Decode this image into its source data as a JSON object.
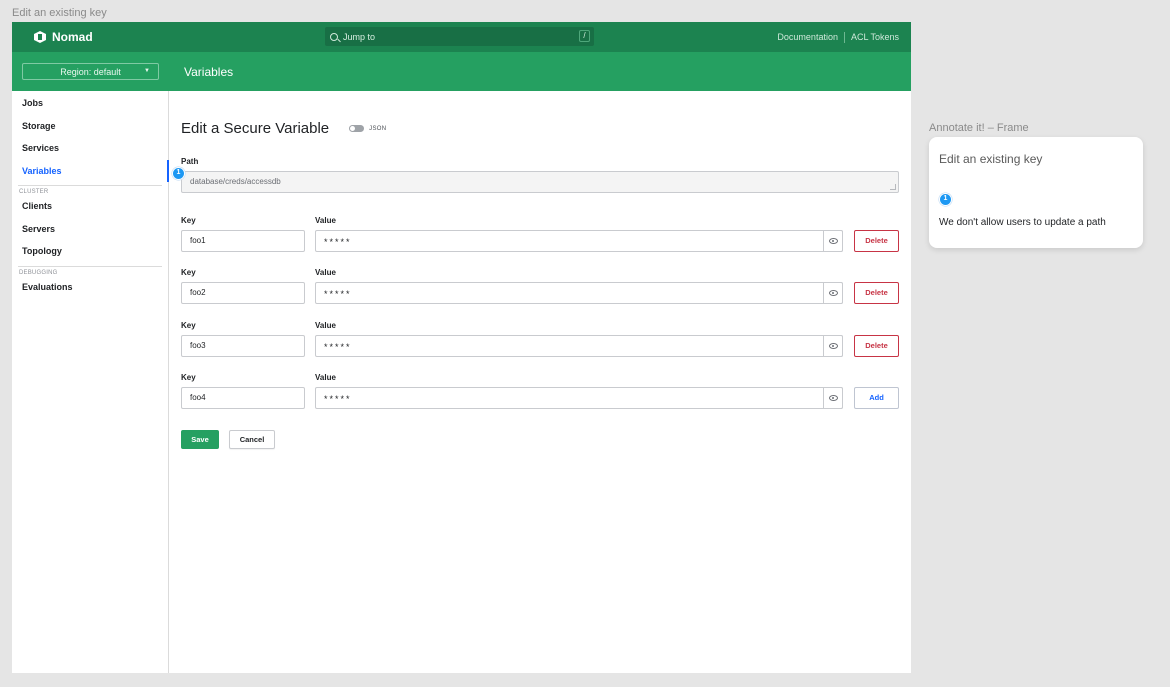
{
  "canvas": {
    "frame_label": "Edit an existing key"
  },
  "header": {
    "brand": "Nomad",
    "search_placeholder": "Jump to",
    "search_shortcut": "/",
    "links": [
      "Documentation",
      "ACL Tokens"
    ]
  },
  "subheader": {
    "region": "Region: default",
    "page_title": "Variables"
  },
  "sidebar": {
    "items_top": [
      {
        "label": "Jobs",
        "active": false
      },
      {
        "label": "Storage",
        "active": false
      },
      {
        "label": "Services",
        "active": false
      },
      {
        "label": "Variables",
        "active": true
      }
    ],
    "section_cluster": "CLUSTER",
    "items_cluster": [
      {
        "label": "Clients"
      },
      {
        "label": "Servers"
      },
      {
        "label": "Topology"
      }
    ],
    "section_debugging": "DEBUGGING",
    "items_debugging": [
      {
        "label": "Evaluations"
      }
    ]
  },
  "form": {
    "title": "Edit a Secure Variable",
    "json_toggle_label": "JSON",
    "path_label": "Path",
    "path_value": "database/creds/accessdb",
    "key_label": "Key",
    "value_label": "Value",
    "rows": [
      {
        "key": "foo1",
        "value": "*****",
        "action": "Delete"
      },
      {
        "key": "foo2",
        "value": "*****",
        "action": "Delete"
      },
      {
        "key": "foo3",
        "value": "*****",
        "action": "Delete"
      },
      {
        "key": "foo4",
        "value": "*****",
        "action": "Add"
      }
    ],
    "save_label": "Save",
    "cancel_label": "Cancel"
  },
  "annotation": {
    "marker": "1",
    "frame_label": "Annotate it! – Frame",
    "card_title": "Edit an existing key",
    "card_text": "We don't allow users to update a path"
  },
  "colors": {
    "header": "#1c8350",
    "subheader": "#25a061",
    "accent": "#1563ff",
    "danger": "#c73445",
    "marker": "#1d98f3"
  }
}
